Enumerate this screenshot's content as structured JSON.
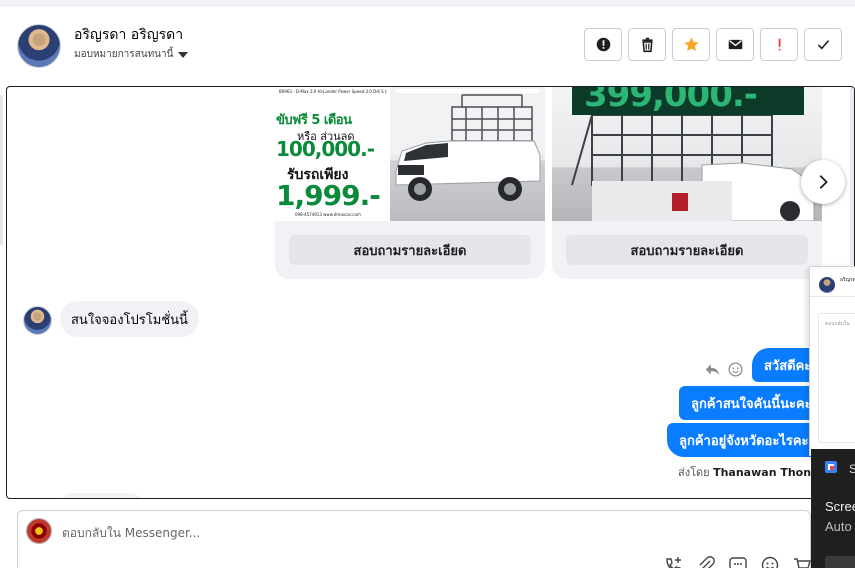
{
  "header": {
    "contact_name": "อริญรดา อริญรดา",
    "assign_label": "มอบหมายการสนทนานี้",
    "actions": [
      {
        "id": "spam",
        "icon": "exclamation-circle-icon"
      },
      {
        "id": "delete",
        "icon": "trash-icon"
      },
      {
        "id": "star",
        "icon": "star-icon",
        "color": "#f5a623"
      },
      {
        "id": "mark-unread",
        "icon": "envelope-icon"
      },
      {
        "id": "follow-up",
        "icon": "exclamation-icon",
        "color": "#e4403d"
      },
      {
        "id": "done",
        "icon": "checkmark-icon"
      }
    ]
  },
  "carousel": {
    "cards": [
      {
        "button_label": "สอบถามรายละเอียด",
        "poster": {
          "small_text": "B0963 - D-Max 3.0 Hi-Lander Power Speed 3.0 Ddi S (MY20) MT",
          "line1": "ขับฟรี 5 เดือน",
          "line2": "หรือ ส่วนลด",
          "line3": "100,000.-",
          "line4": "รับรถเพียง",
          "line5": "1,999.-",
          "footer": "098-4574913 www.dmaxcar.com"
        }
      },
      {
        "button_label": "สอบถามรายละเอียด",
        "price_banner": "399,000.-"
      }
    ]
  },
  "messages": {
    "incoming": [
      {
        "text": "สนใจจองโปรโมชั่นนี้"
      }
    ],
    "outgoing": [
      {
        "text": "สวัสดีคะ"
      },
      {
        "text": "ลูกค้าสนใจคันนี้นะคะ"
      },
      {
        "text": "ลูกค้าอยู่จังหวัดอะไรคะ"
      }
    ],
    "sent_by_prefix": "ส่งโดย",
    "sent_by_name": "Thanawan Thon"
  },
  "floating_panel": {
    "name": "อริญรดา",
    "placeholder": "ตอบกลับใน"
  },
  "toast": {
    "letter": "S",
    "title": "Scree",
    "subtitle": "Auto"
  },
  "composer": {
    "placeholder": "ตอบกลับใน Messenger..."
  },
  "colors": {
    "brand_blue": "#0a7cff",
    "star": "#f5a623",
    "alert_red": "#e4403d",
    "promo_green": "#0a8a3a"
  }
}
